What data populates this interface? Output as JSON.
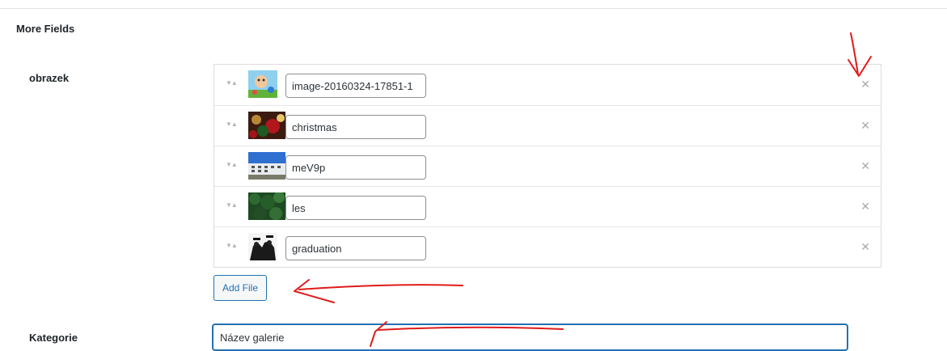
{
  "section": {
    "title": "More Fields"
  },
  "obrazek": {
    "label": "obrazek",
    "files": [
      {
        "name": "image-20160324-17851-1",
        "thumb": "cartoon-thumb-icon"
      },
      {
        "name": "christmas",
        "thumb": "christmas-thumb-icon"
      },
      {
        "name": "meV9p",
        "thumb": "building-thumb-icon"
      },
      {
        "name": "les",
        "thumb": "forest-thumb-icon"
      },
      {
        "name": "graduation",
        "thumb": "graduation-thumb-icon"
      }
    ],
    "sort_icon_glyph": "▼▲",
    "remove_icon_glyph": "✕",
    "add_button_label": "Add File"
  },
  "kategorie": {
    "label": "Kategorie",
    "value": "Název galerie"
  },
  "colors": {
    "accent": "#2271b1",
    "annotation": "#e01b1b",
    "border": "#dcdcde"
  }
}
